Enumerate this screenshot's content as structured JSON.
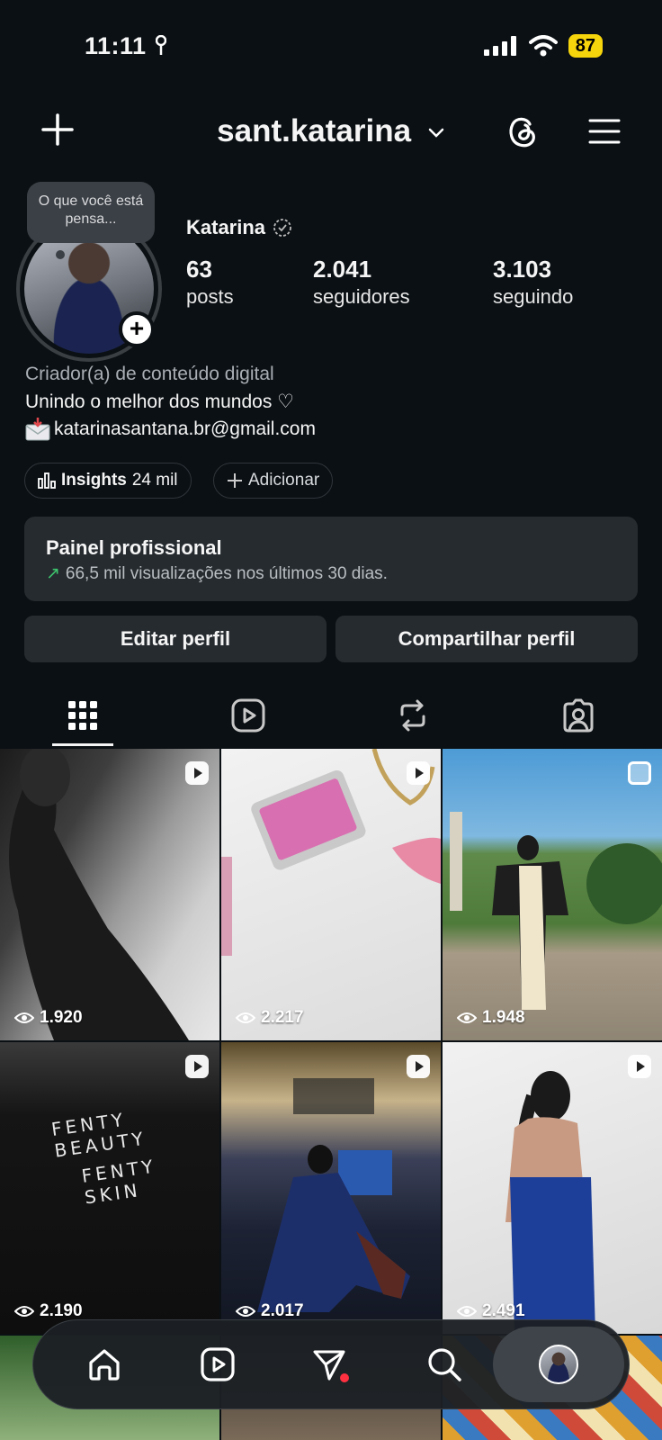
{
  "status_bar": {
    "time": "11:11",
    "battery": "87"
  },
  "header": {
    "username": "sant.katarina"
  },
  "note": {
    "text": "O que você está pensa..."
  },
  "profile": {
    "name": "Katarina",
    "stats": [
      {
        "value": "63",
        "label": "posts"
      },
      {
        "value": "2.041",
        "label": "seguidores"
      },
      {
        "value": "3.103",
        "label": "seguindo"
      }
    ],
    "category": "Criador(a) de conteúdo digital",
    "bio_line": "Unindo o melhor dos mundos ♡",
    "email": "katarinasantana.br@gmail.com"
  },
  "chips": {
    "insights_label": "Insights",
    "insights_value": "24 mil",
    "add_label": "Adicionar"
  },
  "panel": {
    "title": "Painel profissional",
    "subtitle": "66,5 mil visualizações nos últimos 30 dias."
  },
  "buttons": {
    "edit": "Editar perfil",
    "share": "Compartilhar perfil"
  },
  "grid": [
    {
      "views": "1.920",
      "type": "reel"
    },
    {
      "views": "2.217",
      "type": "reel"
    },
    {
      "views": "1.948",
      "type": "carousel"
    },
    {
      "views": "2.190",
      "type": "reel"
    },
    {
      "views": "2.017",
      "type": "reel"
    },
    {
      "views": "2.491",
      "type": "reel"
    }
  ],
  "grid_text": {
    "fenty1": "FENTY BEAUTY",
    "fenty2": "FENTY SKIN"
  },
  "colors": {
    "background": "#0b1014",
    "surface": "#262b30",
    "accent_green": "#3ec46d",
    "notification": "#ff3040",
    "battery": "#f7d50c"
  }
}
